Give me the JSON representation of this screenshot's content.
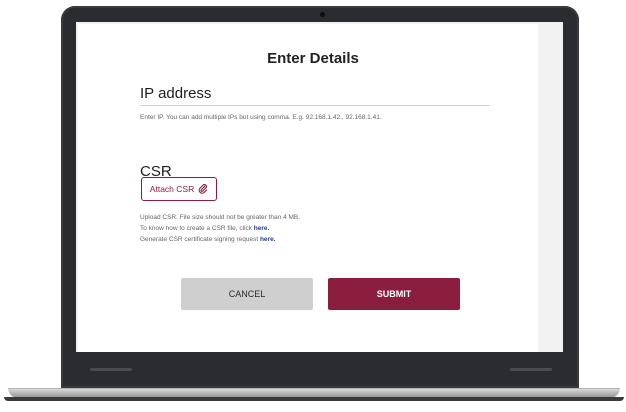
{
  "form": {
    "title": "Enter Details",
    "ip_label": "IP address",
    "ip_hint": "Enter IP. You can add multiple IPs but using comma. E.g. 92.168.1.42., 92.168.1.41.",
    "csr_label": "CSR",
    "attach_label": "Attach CSR",
    "attach_icon": "paperclip-icon",
    "upload_hint": "Upload CSR. File size should not be greater than 4 MB.",
    "howto_text": "To know how to create a CSR file, click ",
    "howto_link": "here.",
    "generate_text": "Generate CSR certificate signing request ",
    "generate_link": "here.",
    "cancel_label": "CANCEL",
    "submit_label": "SUBMIT"
  },
  "colors": {
    "accent": "#8b1e3f",
    "link": "#243f8f",
    "cancel_bg": "#cfcfcf"
  }
}
